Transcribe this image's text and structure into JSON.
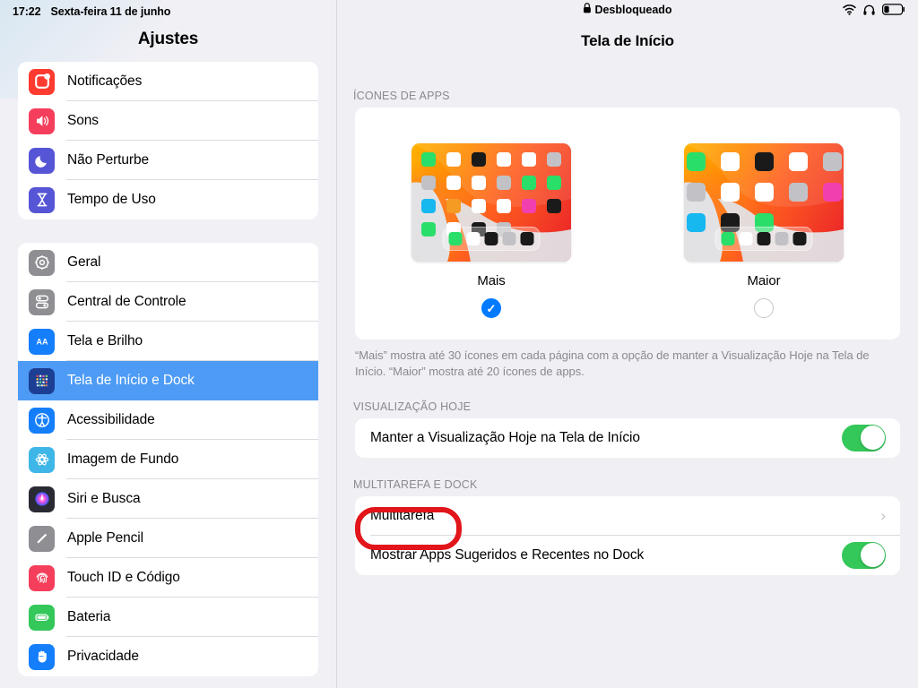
{
  "status_bar": {
    "time": "17:22",
    "date": "Sexta-feira 11 de junho",
    "lock_state": "Desbloqueado",
    "lock_icon": "lock-icon",
    "wifi_icon": "wifi-icon",
    "headphones_icon": "headphones-icon",
    "battery_icon": "battery-low-icon"
  },
  "sidebar": {
    "title": "Ajustes",
    "groups": [
      {
        "items": [
          {
            "label": "Notificações",
            "icon": "notifications-icon",
            "color": "#ff3b30",
            "selected": false
          },
          {
            "label": "Sons",
            "icon": "sounds-icon",
            "color": "#f53e5c",
            "selected": false
          },
          {
            "label": "Não Perturbe",
            "icon": "moon-icon",
            "color": "#5655d6",
            "selected": false
          },
          {
            "label": "Tempo de Uso",
            "icon": "hourglass-icon",
            "color": "#5655d6",
            "selected": false
          }
        ]
      },
      {
        "items": [
          {
            "label": "Geral",
            "icon": "gear-icon",
            "color": "#8e8e93",
            "selected": false
          },
          {
            "label": "Central de Controle",
            "icon": "control-center-icon",
            "color": "#8e8e93",
            "selected": false
          },
          {
            "label": "Tela e Brilho",
            "icon": "display-brightness-icon",
            "color": "#147efb",
            "selected": false
          },
          {
            "label": "Tela de Início e Dock",
            "icon": "home-screen-dock-icon",
            "color": "#1c3f94",
            "selected": true
          },
          {
            "label": "Acessibilidade",
            "icon": "accessibility-icon",
            "color": "#147efb",
            "selected": false
          },
          {
            "label": "Imagem de Fundo",
            "icon": "wallpaper-icon",
            "color": "#3fb6e8",
            "selected": false
          },
          {
            "label": "Siri e Busca",
            "icon": "siri-icon",
            "color": "#2a2a35",
            "selected": false
          },
          {
            "label": "Apple Pencil",
            "icon": "pencil-icon",
            "color": "#8e8e93",
            "selected": false
          },
          {
            "label": "Touch ID e Código",
            "icon": "fingerprint-icon",
            "color": "#f53e5c",
            "selected": false
          },
          {
            "label": "Bateria",
            "icon": "battery-icon",
            "color": "#34c759",
            "selected": false
          },
          {
            "label": "Privacidade",
            "icon": "privacy-hand-icon",
            "color": "#147efb",
            "selected": false
          }
        ]
      }
    ]
  },
  "main": {
    "title": "Tela de Início",
    "sections": {
      "app_icons": {
        "header": "ÍCONES DE APPS",
        "options": [
          {
            "label": "Mais",
            "selected": true,
            "columns": 6
          },
          {
            "label": "Maior",
            "selected": false,
            "columns": 5
          }
        ],
        "footnote": "“Mais” mostra até 30 ícones em cada página com a opção de manter a Visualização Hoje na Tela de Início. “Maior” mostra até 20 ícones de apps."
      },
      "today_view": {
        "header": "VISUALIZAÇÃO HOJE",
        "rows": [
          {
            "label": "Manter a Visualização Hoje na Tela de Início",
            "control": "toggle",
            "value": "on"
          }
        ]
      },
      "multitasking_dock": {
        "header": "MULTITAREFA E DOCK",
        "rows": [
          {
            "label": "Multitarefa",
            "control": "chevron",
            "value": "›",
            "highlighted": true
          },
          {
            "label": "Mostrar Apps Sugeridos e Recentes no Dock",
            "control": "toggle",
            "value": "on"
          }
        ]
      }
    }
  },
  "annotation": {
    "color": "#e1151a",
    "target": "Multitarefa"
  },
  "preview_grids": {
    "mais": [
      [
        "#2ade6a",
        "#ffffff",
        "#1a1a1a",
        "#ffffff",
        "#ffffff",
        "#c2c2c6"
      ],
      [
        "#c2c2c6",
        "#ffffff",
        "#ffffff",
        "#c2c2c6",
        "#2ade6a",
        "#2ade6a"
      ],
      [
        "#17b7f0",
        "#f59a22",
        "#ffffff",
        "#ffffff",
        "#f23fb0",
        "#1a1a1a"
      ],
      [
        "#2ade6a",
        "#ffffff",
        "#1a1a1a",
        "#c2c2c6",
        "",
        ""
      ]
    ],
    "mais_dock": [
      "#2ade6a",
      "#ffffff",
      "#1a1a1a",
      "#c2c2c6",
      "#1a1a1a"
    ],
    "maior": [
      [
        "#2ade6a",
        "#ffffff",
        "#1a1a1a",
        "#ffffff",
        "#c2c2c6"
      ],
      [
        "#c2c2c6",
        "#ffffff",
        "#ffffff",
        "#c2c2c6",
        "#f23fb0"
      ],
      [
        "#17b7f0",
        "#1a1a1a",
        "#2ade6a",
        "",
        ""
      ]
    ],
    "maior_dock": [
      "#2ade6a",
      "#ffffff",
      "#1a1a1a",
      "#c2c2c6",
      "#1a1a1a"
    ]
  }
}
